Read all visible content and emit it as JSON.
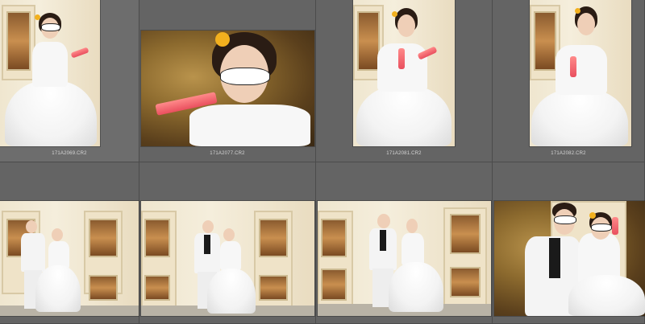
{
  "filmstrip": {
    "row1": [
      {
        "filename": "171A2069.CR2"
      },
      {
        "filename": "171A2077.CR2"
      },
      {
        "filename": "171A2081.CR2"
      },
      {
        "filename": "171A2082.CR2"
      }
    ]
  },
  "colors": {
    "panel_bg": "#646464",
    "grid_line": "#4b4b4b",
    "label_text": "#d6d6d6",
    "bottle_pink": "#e94f5e",
    "flower_yellow": "#f2b01e"
  }
}
